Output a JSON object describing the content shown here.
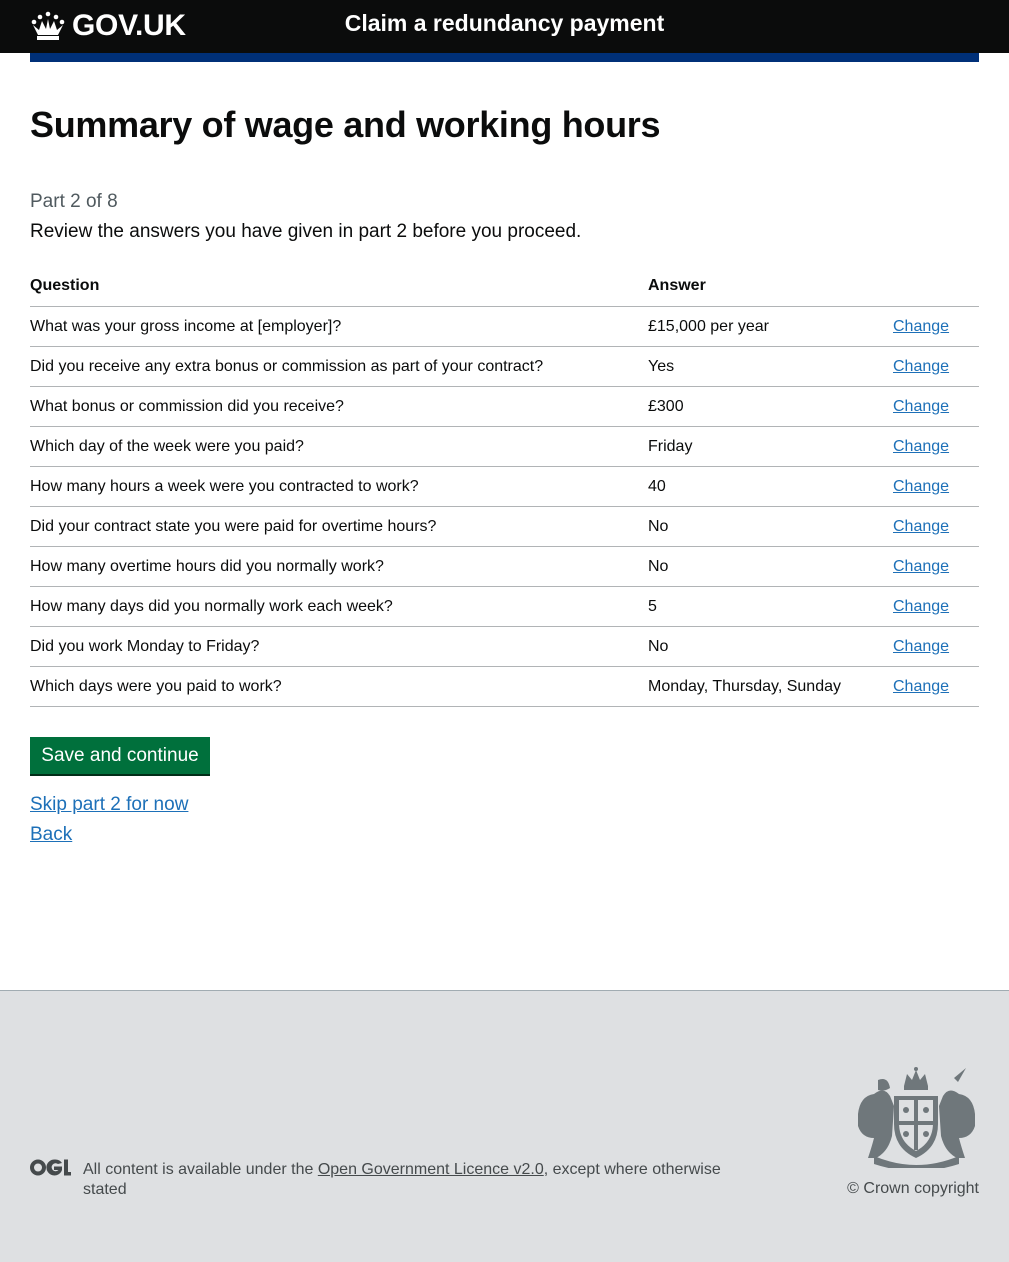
{
  "header": {
    "logo_text": "GOV.UK",
    "service_name": "Claim a redundancy payment",
    "accent_color": "#1d70b8"
  },
  "page": {
    "title": "Summary of wage and working hours",
    "caption": "Part 2 of 8",
    "lead": "Review the answers you have given in part 2 before you proceed."
  },
  "table": {
    "headers": {
      "question": "Question",
      "answer": "Answer"
    },
    "rows": [
      {
        "question": "What was your gross income at [employer]?",
        "answer": "£15,000 per year",
        "action": "Change"
      },
      {
        "question": "Did you receive any extra bonus or commission as part of your contract?",
        "answer": "Yes",
        "action": "Change"
      },
      {
        "question": "What bonus or commission did you receive?",
        "answer": "£300",
        "action": "Change"
      },
      {
        "question": "Which day of the week were you paid?",
        "answer": "Friday",
        "action": "Change"
      },
      {
        "question": "How many hours a week were you contracted to work?",
        "answer": "40",
        "action": "Change"
      },
      {
        "question": "Did your contract state you were paid for overtime hours?",
        "answer": "No",
        "action": "Change"
      },
      {
        "question": "How many overtime hours did you normally work?",
        "answer": "No",
        "action": "Change"
      },
      {
        "question": "How many days did you normally work each week?",
        "answer": "5",
        "action": "Change"
      },
      {
        "question": "Did you work Monday to Friday?",
        "answer": "No",
        "action": "Change"
      },
      {
        "question": "Which days were you paid to work?",
        "answer": "Monday, Thursday, Sunday",
        "action": "Change"
      }
    ]
  },
  "actions": {
    "save_label": "Save and continue",
    "skip_label": "Skip part 2 for now",
    "back_label": "Back",
    "button_color": "#00703c",
    "link_color": "#1d70b8"
  },
  "footer": {
    "licence_prefix": "All content is available under the",
    "licence_link": "Open Government Licence v2.0",
    "licence_suffix": ", except where otherwise stated",
    "copyright": "© Crown copyright",
    "ogl_icon": "ogl-logo-icon",
    "crest_icon": "royal-coat-of-arms-icon"
  }
}
